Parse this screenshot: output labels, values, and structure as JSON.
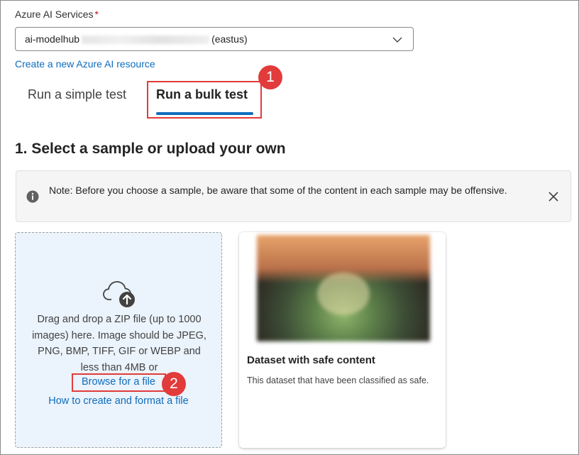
{
  "service": {
    "label": "Azure AI Services",
    "required_mark": "*",
    "selected_prefix": "ai-modelhub",
    "selected_suffix": "(eastus)",
    "create_link": "Create a new Azure AI resource"
  },
  "tabs": [
    {
      "label": "Run a simple test",
      "selected": false
    },
    {
      "label": "Run a bulk test",
      "selected": true
    }
  ],
  "callouts": [
    "1",
    "2"
  ],
  "section": {
    "title": "1. Select a sample or upload your own"
  },
  "banner": {
    "text": "Note: Before you choose a sample, be aware that some of the content in each sample may be offensive.",
    "icon": "info-icon",
    "close_icon": "close-icon"
  },
  "upload": {
    "icon": "cloud-upload-icon",
    "description": "Drag and drop a ZIP file (up to 1000 images) here. Image should be JPEG, PNG, BMP, TIFF, GIF or WEBP and less than 4MB or",
    "browse_link": "Browse for a file",
    "howto_link": "How to create and format a file"
  },
  "sample_card": {
    "title": "Dataset with safe content",
    "description": "This dataset that have been classified as safe."
  },
  "colors": {
    "accent": "#0f6cbd",
    "annotation_red": "#e23b3b",
    "dropzone_bg": "#ebf3fc"
  }
}
